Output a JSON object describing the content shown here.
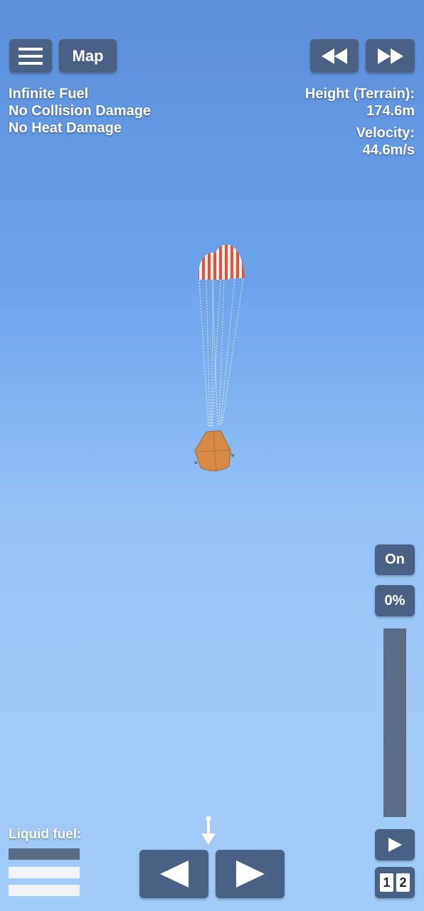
{
  "toolbar": {
    "map_label": "Map"
  },
  "cheats": [
    "Infinite Fuel",
    "No Collision Damage",
    "No Heat Damage"
  ],
  "telemetry": {
    "height_label": "Height (Terrain):",
    "height_value": "174.6m",
    "velocity_label": "Velocity:",
    "velocity_value": "44.6m/s"
  },
  "engine": {
    "toggle_label": "On",
    "throttle_label": "0%",
    "throttle_level": 0
  },
  "fuel": {
    "label": "Liquid fuel:"
  },
  "stage": {
    "digits": [
      "1",
      "2"
    ]
  },
  "colors": {
    "button": "#4a6185",
    "parachute_red": "#d9573f",
    "capsule": "#d78b46"
  }
}
